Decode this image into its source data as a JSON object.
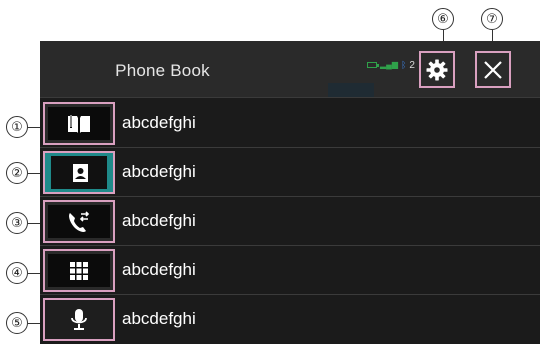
{
  "header": {
    "title": "Phone Book",
    "status": {
      "bluetooth_device_number": "2"
    },
    "settings_button": {
      "icon": "gear-icon"
    },
    "close_button": {
      "icon": "close-icon"
    }
  },
  "rows": [
    {
      "icon": "phone-book-icon",
      "label": "abcdefghi"
    },
    {
      "icon": "contact-card-icon",
      "label": "abcdefghi"
    },
    {
      "icon": "call-history-icon",
      "label": "abcdefghi"
    },
    {
      "icon": "dial-pad-icon",
      "label": "abcdefghi"
    },
    {
      "icon": "microphone-icon",
      "label": "abcdefghi"
    }
  ],
  "callouts": {
    "c1": "①",
    "c2": "②",
    "c3": "③",
    "c4": "④",
    "c5": "⑤",
    "c6": "⑥",
    "c7": "⑦"
  },
  "colors": {
    "screen_bg": "#1b1b1b",
    "highlight_border": "#d9a0c0",
    "contact_teal": "#1f8a8a",
    "status_green": "#2fa14a",
    "bluetooth_blue": "#3a7bd5"
  }
}
